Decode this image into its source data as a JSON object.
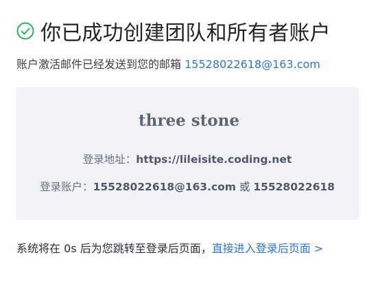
{
  "header": {
    "title": "你已成功创建团队和所有者账户"
  },
  "notice": {
    "text": "账户激活邮件已经发送到您的邮箱 ",
    "email": "15528022618@163.com"
  },
  "card": {
    "team_name": "three stone",
    "login_url_label": "登录地址：",
    "login_url": "https://lileisite.coding.net",
    "account_label": "登录账户：",
    "account_email": "15528022618@163.com",
    "or_text": " 或 ",
    "account_phone": "15528022618"
  },
  "footer": {
    "text": "系统将在 0s 后为您跳转至登录后页面，",
    "link": "直接进入登录后页面 >"
  },
  "colors": {
    "success": "#2bb35d",
    "link": "#2f74d0",
    "card_bg": "#f2f3f6"
  },
  "icons": {
    "title_icon": "check-circle-icon"
  }
}
